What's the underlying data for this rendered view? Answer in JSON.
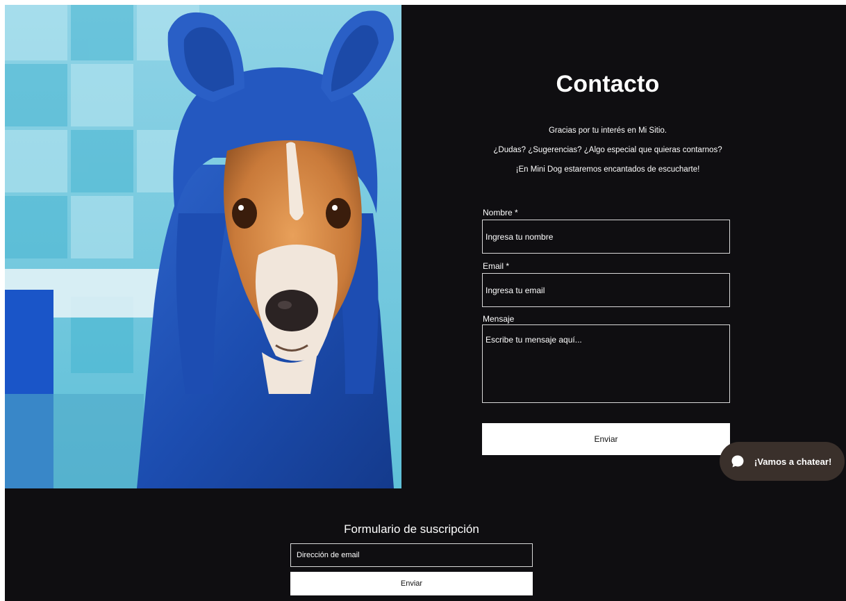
{
  "contact": {
    "title": "Contacto",
    "intro_lines": [
      "Gracias por tu interés en Mi Sitio.",
      "¿Dudas? ¿Sugerencias? ¿Algo especial que quieras contarnos?",
      "¡En Mini Dog estaremos encantados de escucharte!"
    ]
  },
  "form": {
    "name_label": "Nombre *",
    "name_placeholder": "Ingresa tu nombre",
    "email_label": "Email *",
    "email_placeholder": "Ingresa tu email",
    "message_label": "Mensaje",
    "message_placeholder": "Escribe tu mensaje aquí...",
    "submit_label": "Enviar"
  },
  "chat": {
    "label": "¡Vamos a chatear!",
    "icon": "chat-bubble-icon"
  },
  "subscription": {
    "title": "Formulario de suscripción",
    "email_placeholder": "Dirección de email",
    "submit_label": "Enviar"
  },
  "colors": {
    "background": "#0f0e11",
    "button": "#ffffff",
    "chat_bubble": "#3a302b",
    "towel": "#1f4fb0"
  }
}
